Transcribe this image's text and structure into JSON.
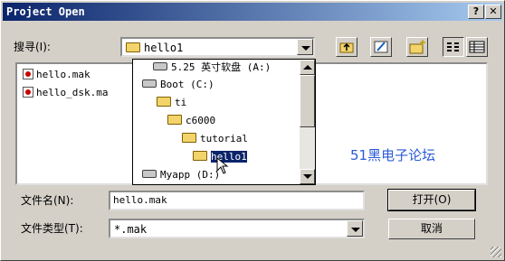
{
  "window": {
    "title": "Project Open",
    "help_btn": "?",
    "close_btn": "✕"
  },
  "search": {
    "label": "搜寻(I):",
    "value": "hello1"
  },
  "files": [
    {
      "name": "hello.mak"
    },
    {
      "name": "hello_dsk.ma"
    }
  ],
  "dropdown": {
    "items": [
      {
        "label": "5.25 英寸软盘 (A:)",
        "type": "drive"
      },
      {
        "label": "Boot (C:)",
        "type": "drive"
      },
      {
        "label": "ti",
        "type": "folder"
      },
      {
        "label": "c6000",
        "type": "folder"
      },
      {
        "label": "tutorial",
        "type": "folder"
      },
      {
        "label": "hello1",
        "type": "folder-open",
        "selected": true
      },
      {
        "label": "Myapp (D:)",
        "type": "drive"
      }
    ]
  },
  "watermark": "51黑电子论坛",
  "filename": {
    "label": "文件名(N):",
    "value": "hello.mak"
  },
  "filetype": {
    "label": "文件类型(T):",
    "value": "*.mak"
  },
  "buttons": {
    "open": "打开(O)",
    "cancel": "取消"
  }
}
